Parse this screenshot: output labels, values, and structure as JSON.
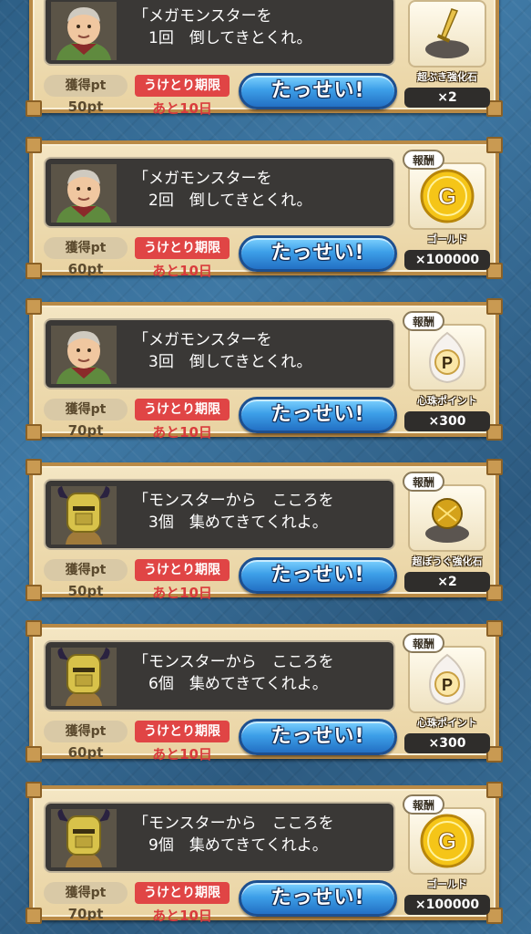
{
  "labels": {
    "pt_label": "獲得pt",
    "deadline_label": "うけとり期限",
    "deadline_value": "あと10日",
    "achieve_button": "たっせい!",
    "reward_tag": "報酬"
  },
  "missions": [
    {
      "message": "「メガモンスターを\n　1回　倒してきとくれ。",
      "pt": "50pt",
      "portrait": "old-woman-icon",
      "reward_name": "超ぶき強化石",
      "reward_qty": "×2",
      "reward_icon": "sword-stone-icon",
      "show_tag": false
    },
    {
      "message": "「メガモンスターを\n　2回　倒してきとくれ。",
      "pt": "60pt",
      "portrait": "old-woman-icon",
      "reward_name": "ゴールド",
      "reward_qty": "×100000",
      "reward_icon": "gold-coin-icon",
      "show_tag": true
    },
    {
      "message": "「メガモンスターを\n　3回　倒してきとくれ。",
      "pt": "70pt",
      "portrait": "old-woman-icon",
      "reward_name": "心珠ポイント",
      "reward_qty": "×300",
      "reward_icon": "p-orb-icon",
      "show_tag": true
    },
    {
      "message": "「モンスターから　こころを\n　3個　集めてきてくれよ。",
      "pt": "50pt",
      "portrait": "knight-icon",
      "reward_name": "超ぼうぐ強化石",
      "reward_qty": "×2",
      "reward_icon": "shield-stone-icon",
      "show_tag": true
    },
    {
      "message": "「モンスターから　こころを\n　6個　集めてきてくれよ。",
      "pt": "60pt",
      "portrait": "knight-icon",
      "reward_name": "心珠ポイント",
      "reward_qty": "×300",
      "reward_icon": "p-orb-icon",
      "show_tag": true
    },
    {
      "message": "「モンスターから　こころを\n　9個　集めてきてくれよ。",
      "pt": "70pt",
      "portrait": "knight-icon",
      "reward_name": "ゴールド",
      "reward_qty": "×100000",
      "reward_icon": "gold-coin-icon",
      "show_tag": true
    }
  ]
}
